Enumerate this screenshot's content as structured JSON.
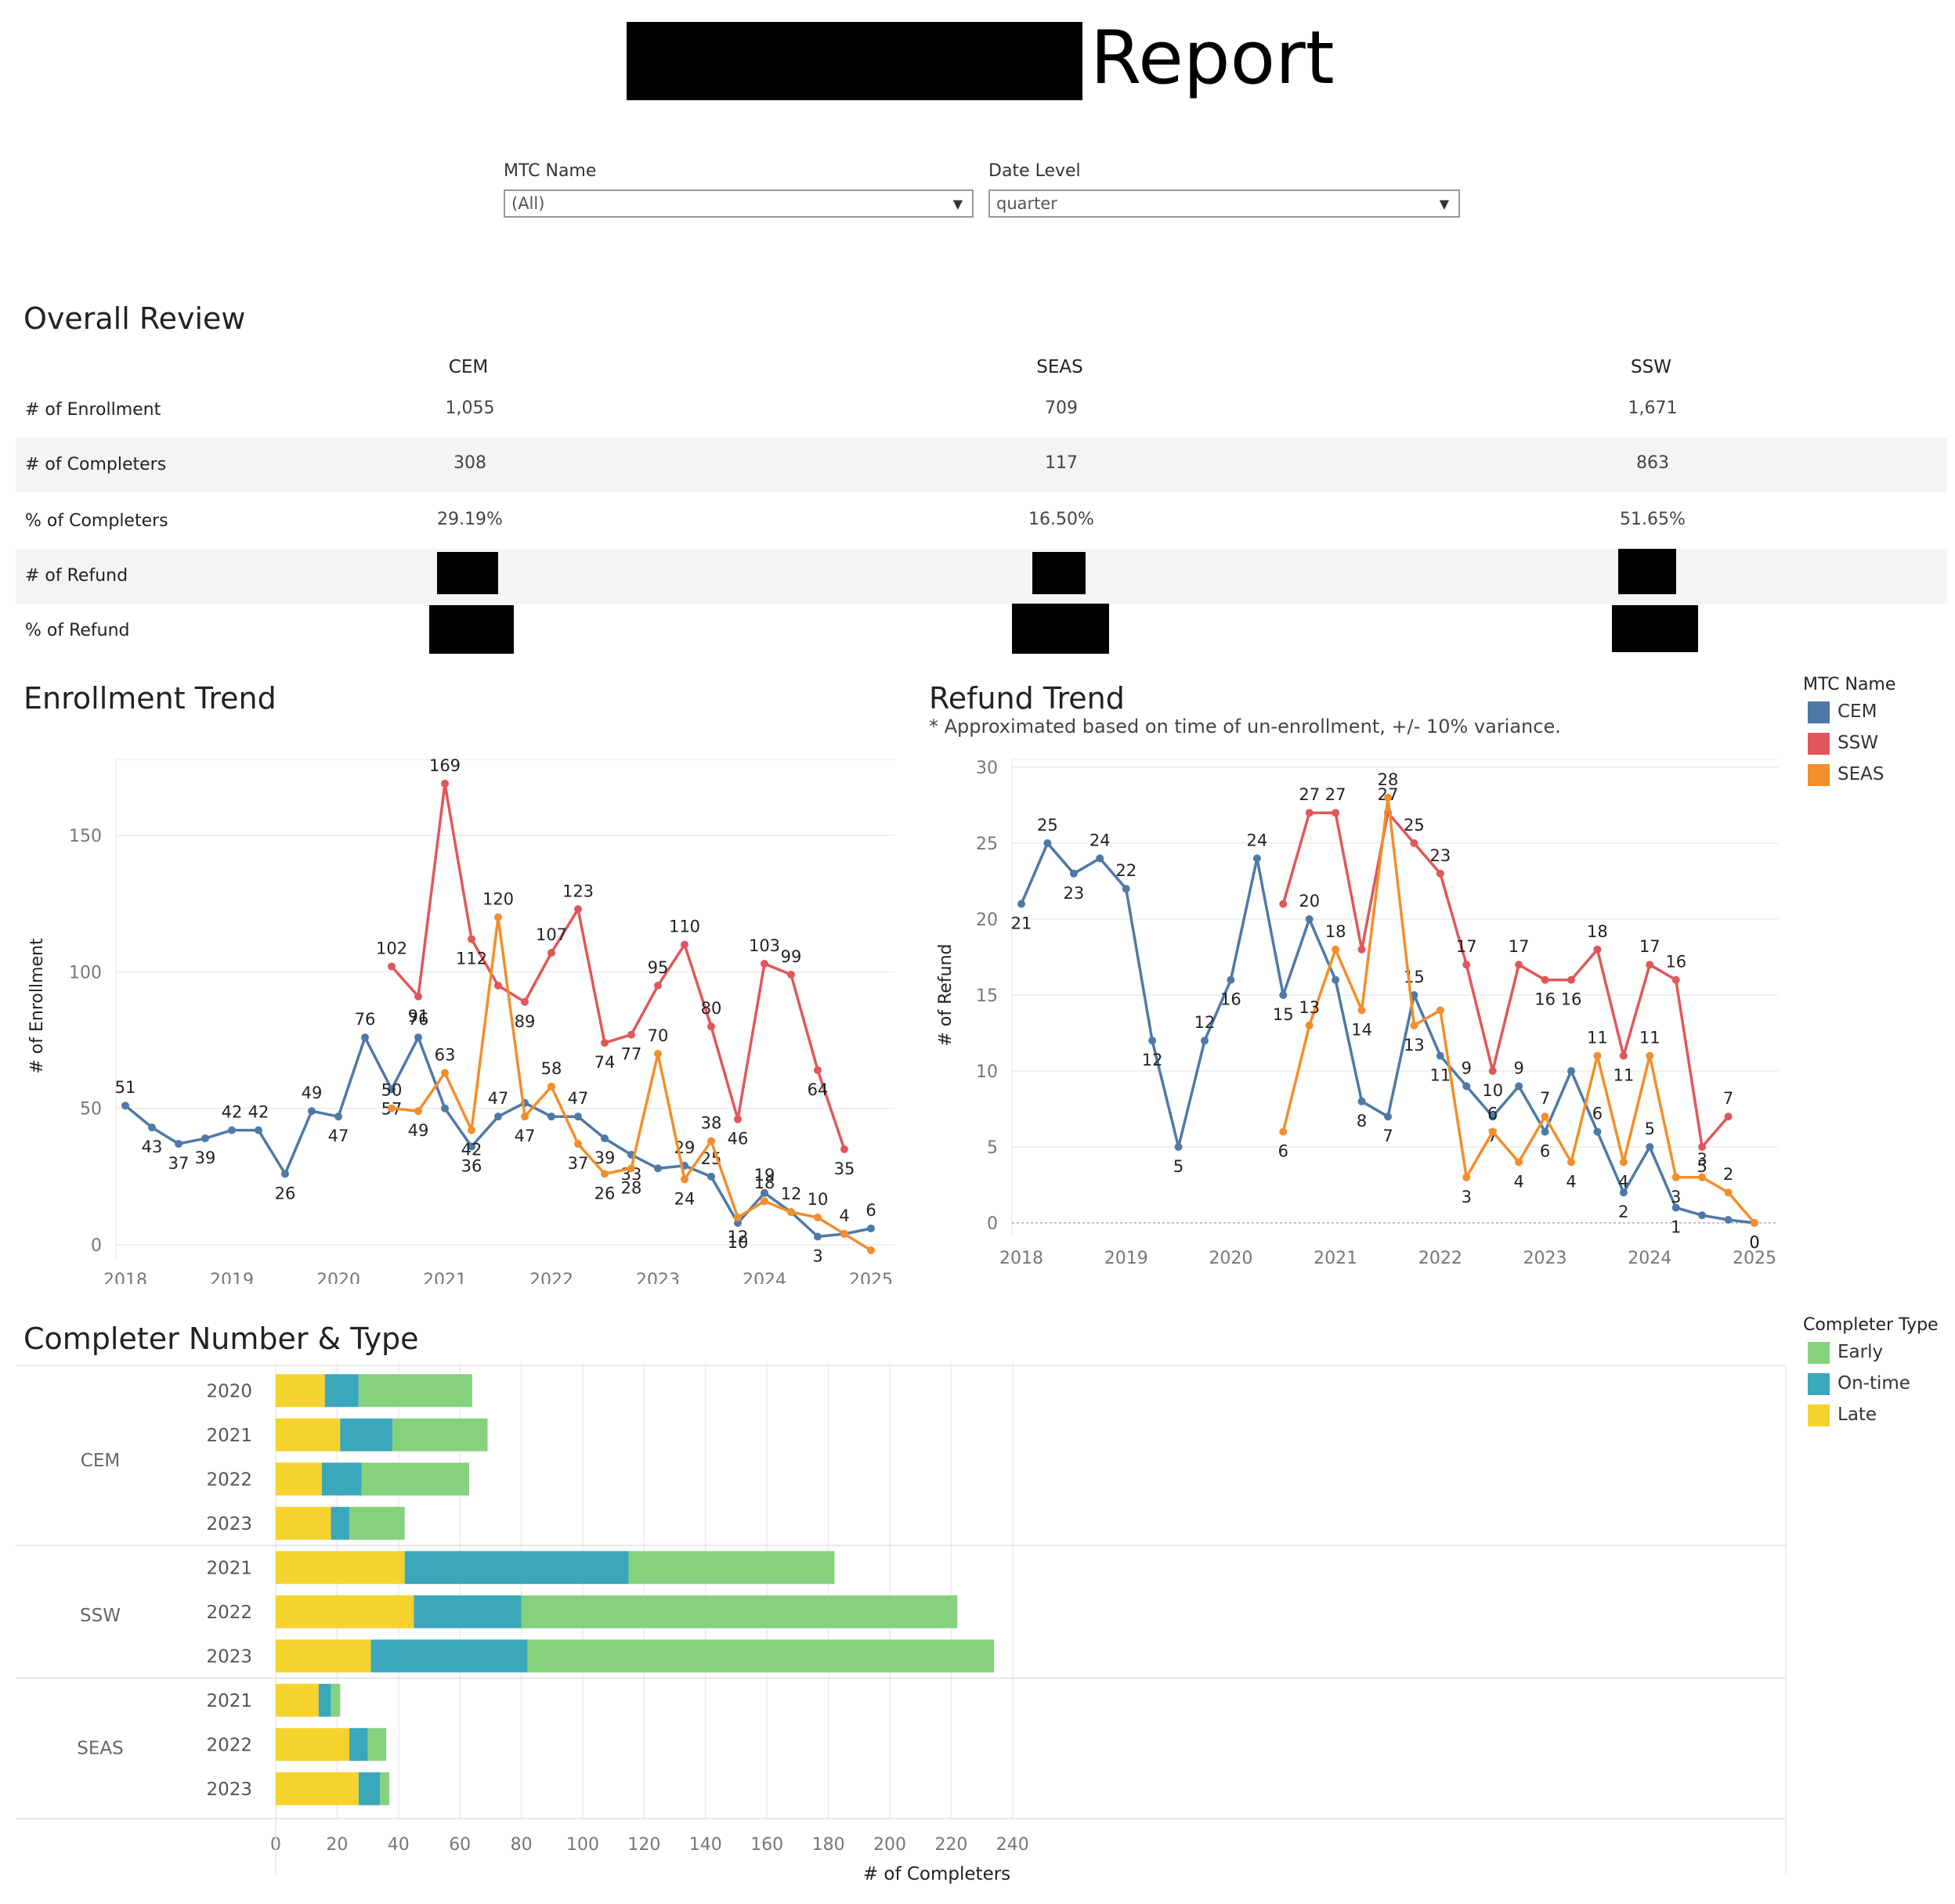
{
  "header": {
    "title_suffix": "Report"
  },
  "filters": [
    {
      "label": "MTC Name",
      "value": "(All)"
    },
    {
      "label": "Date Level",
      "value": "quarter"
    }
  ],
  "overall": {
    "title": "Overall Review",
    "columns": [
      "CEM",
      "SEAS",
      "SSW"
    ],
    "rows": [
      {
        "label": "# of Enrollment",
        "values": [
          "1,055",
          "709",
          "1,671"
        ]
      },
      {
        "label": "# of Completers",
        "values": [
          "308",
          "117",
          "863"
        ]
      },
      {
        "label": "% of Completers",
        "values": [
          "29.19%",
          "16.50%",
          "51.65%"
        ]
      },
      {
        "label": "# of Refund",
        "values": [
          "",
          "",
          ""
        ]
      },
      {
        "label": "% of Refund",
        "values": [
          "",
          "",
          ""
        ]
      }
    ]
  },
  "legend_mtc": {
    "title": "MTC Name",
    "items": [
      {
        "label": "CEM",
        "color": "#4e79a7"
      },
      {
        "label": "SSW",
        "color": "#e15759"
      },
      {
        "label": "SEAS",
        "color": "#f28e2b"
      }
    ]
  },
  "legend_completer": {
    "title": "Completer Type",
    "items": [
      {
        "label": "Early",
        "color": "#86d17d"
      },
      {
        "label": "On-time",
        "color": "#3ba7bb"
      },
      {
        "label": "Late",
        "color": "#f5d22d"
      }
    ]
  },
  "chart_data": [
    {
      "type": "line",
      "title": "Enrollment Trend",
      "ylabel": "# of Enrollment",
      "xlim": [
        2018,
        2025
      ],
      "ylim": [
        0,
        175
      ],
      "xticks": [
        "2018",
        "2019",
        "2020",
        "2021",
        "2022",
        "2023",
        "2024",
        "2025"
      ],
      "yticks": [
        "0",
        "50",
        "100",
        "150"
      ],
      "series": [
        {
          "name": "CEM",
          "color": "#4e79a7",
          "x": [
            2018.0,
            2018.25,
            2018.5,
            2018.75,
            2019.0,
            2019.25,
            2019.5,
            2019.75,
            2020.0,
            2020.25,
            2020.5,
            2020.75,
            2021.0,
            2021.25,
            2021.5,
            2021.75,
            2022.0,
            2022.25,
            2022.5,
            2022.75,
            2023.0,
            2023.25,
            2023.5,
            2023.75,
            2024.0,
            2024.25,
            2024.5,
            2024.75,
            2025.0
          ],
          "y": [
            51,
            43,
            37,
            39,
            42,
            42,
            26,
            49,
            47,
            76,
            57,
            76,
            50,
            36,
            47,
            52,
            47,
            47,
            39,
            33,
            28,
            29,
            25,
            8,
            19,
            12,
            3,
            4,
            6
          ],
          "labels": [
            "51",
            "43",
            "37",
            "39",
            "42",
            "42",
            "26",
            "49",
            "47",
            "76",
            "57",
            "76",
            "",
            "36",
            "47",
            "",
            "",
            "47",
            "39",
            "33",
            "",
            "29",
            "25",
            "10",
            "19",
            "12",
            "3",
            "",
            "6"
          ]
        },
        {
          "name": "SSW",
          "color": "#e15759",
          "x": [
            2020.5,
            2020.75,
            2021.0,
            2021.25,
            2021.5,
            2021.75,
            2022.0,
            2022.25,
            2022.5,
            2022.75,
            2023.0,
            2023.25,
            2023.5,
            2023.75,
            2024.0,
            2024.25,
            2024.5,
            2024.75
          ],
          "y": [
            102,
            91,
            169,
            112,
            95,
            89,
            107,
            123,
            74,
            77,
            95,
            110,
            80,
            46,
            103,
            99,
            64,
            35
          ],
          "labels": [
            "102",
            "91",
            "169",
            "112",
            "",
            "89",
            "107",
            "123",
            "74",
            "77",
            "95",
            "110",
            "80",
            "46",
            "103",
            "99",
            "64",
            "35"
          ]
        },
        {
          "name": "SEAS",
          "color": "#f28e2b",
          "x": [
            2020.5,
            2020.75,
            2021.0,
            2021.25,
            2021.5,
            2021.75,
            2022.0,
            2022.25,
            2022.5,
            2022.75,
            2023.0,
            2023.25,
            2023.5,
            2023.75,
            2024.0,
            2024.25,
            2024.5,
            2024.75,
            2025.0
          ],
          "y": [
            50,
            49,
            63,
            42,
            120,
            47,
            58,
            37,
            26,
            28,
            70,
            24,
            38,
            10,
            16,
            12,
            10,
            4,
            -2
          ],
          "labels": [
            "50",
            "49",
            "63",
            "42",
            "120",
            "47",
            "58",
            "37",
            "26",
            "28",
            "70",
            "24",
            "38",
            "12",
            "18",
            "",
            "10",
            "4",
            ""
          ]
        }
      ]
    },
    {
      "type": "line",
      "title": "Refund Trend",
      "subtitle": "* Approximated based on time of un-enrollment, +/- 10%  variance.",
      "ylabel": "# of Refund",
      "xlim": [
        2018,
        2025
      ],
      "ylim": [
        0,
        30
      ],
      "xticks": [
        "2018",
        "2019",
        "2020",
        "2021",
        "2022",
        "2023",
        "2024",
        "2025"
      ],
      "yticks": [
        "0",
        "5",
        "10",
        "15",
        "20",
        "25",
        "30"
      ],
      "series": [
        {
          "name": "CEM",
          "color": "#4e79a7",
          "x": [
            2018.0,
            2018.25,
            2018.5,
            2018.75,
            2019.0,
            2019.25,
            2019.5,
            2019.75,
            2020.0,
            2020.25,
            2020.5,
            2020.75,
            2021.0,
            2021.25,
            2021.5,
            2021.75,
            2022.0,
            2022.25,
            2022.5,
            2022.75,
            2023.0,
            2023.25,
            2023.5,
            2023.75,
            2024.0,
            2024.25,
            2024.5,
            2024.75,
            2025.0
          ],
          "y": [
            21,
            25,
            23,
            24,
            22,
            12,
            5,
            12,
            16,
            24,
            15,
            20,
            16,
            8,
            7,
            15,
            11,
            9,
            7,
            9,
            6,
            10,
            6,
            2,
            5,
            1,
            0.5,
            0.2,
            0
          ],
          "labels": [
            "21",
            "25",
            "23",
            "24",
            "22",
            "12",
            "5",
            "12",
            "16",
            "24",
            "15",
            "20",
            "",
            "8",
            "7",
            "15",
            "11",
            "9",
            "7",
            "9",
            "6",
            "",
            "6",
            "2",
            "5",
            "1",
            "",
            "",
            "0"
          ]
        },
        {
          "name": "SSW",
          "color": "#e15759",
          "x": [
            2020.5,
            2020.75,
            2021.0,
            2021.25,
            2021.5,
            2021.75,
            2022.0,
            2022.25,
            2022.5,
            2022.75,
            2023.0,
            2023.25,
            2023.5,
            2023.75,
            2024.0,
            2024.25,
            2024.5,
            2024.75
          ],
          "y": [
            21,
            27,
            27,
            18,
            27,
            25,
            23,
            17,
            10,
            17,
            16,
            16,
            18,
            11,
            17,
            16,
            5,
            7
          ],
          "labels": [
            "",
            "27",
            "27",
            "",
            "27",
            "25",
            "23",
            "17",
            "10",
            "17",
            "16",
            "16",
            "18",
            "11",
            "17",
            "16",
            "5",
            "7"
          ]
        },
        {
          "name": "SEAS",
          "color": "#f28e2b",
          "x": [
            2020.5,
            2020.75,
            2021.0,
            2021.25,
            2021.5,
            2021.75,
            2022.0,
            2022.25,
            2022.5,
            2022.75,
            2023.0,
            2023.25,
            2023.5,
            2023.75,
            2024.0,
            2024.25,
            2024.5,
            2024.75,
            2025.0
          ],
          "y": [
            6,
            13,
            18,
            14,
            28,
            13,
            14,
            3,
            6,
            4,
            7,
            4,
            11,
            4,
            11,
            3,
            3,
            2,
            0
          ],
          "labels": [
            "6",
            "13",
            "18",
            "14",
            "28",
            "13",
            "",
            "3",
            "6",
            "4",
            "7",
            "4",
            "11",
            "4",
            "11",
            "3",
            "3",
            "2",
            "0"
          ]
        }
      ]
    },
    {
      "type": "bar",
      "orientation": "horizontal",
      "stacked": true,
      "title": "Completer Number & Type",
      "xlabel": "# of Completers",
      "xlim": [
        0,
        245
      ],
      "xticks": [
        "0",
        "20",
        "40",
        "60",
        "80",
        "100",
        "120",
        "140",
        "160",
        "180",
        "200",
        "220",
        "240"
      ],
      "series_order": [
        "Late",
        "On-time",
        "Early"
      ],
      "groups": [
        {
          "name": "CEM",
          "rows": [
            {
              "year": "2020",
              "Late": 16,
              "On-time": 11,
              "Early": 37
            },
            {
              "year": "2021",
              "Late": 21,
              "On-time": 17,
              "Early": 31
            },
            {
              "year": "2022",
              "Late": 15,
              "On-time": 13,
              "Early": 35
            },
            {
              "year": "2023",
              "Late": 18,
              "On-time": 6,
              "Early": 18
            }
          ]
        },
        {
          "name": "SSW",
          "rows": [
            {
              "year": "2021",
              "Late": 42,
              "On-time": 73,
              "Early": 67
            },
            {
              "year": "2022",
              "Late": 45,
              "On-time": 35,
              "Early": 142
            },
            {
              "year": "2023",
              "Late": 31,
              "On-time": 51,
              "Early": 152
            }
          ]
        },
        {
          "name": "SEAS",
          "rows": [
            {
              "year": "2021",
              "Late": 14,
              "On-time": 4,
              "Early": 3
            },
            {
              "year": "2022",
              "Late": 24,
              "On-time": 6,
              "Early": 6
            },
            {
              "year": "2023",
              "Late": 27,
              "On-time": 7,
              "Early": 3
            }
          ]
        }
      ]
    }
  ]
}
